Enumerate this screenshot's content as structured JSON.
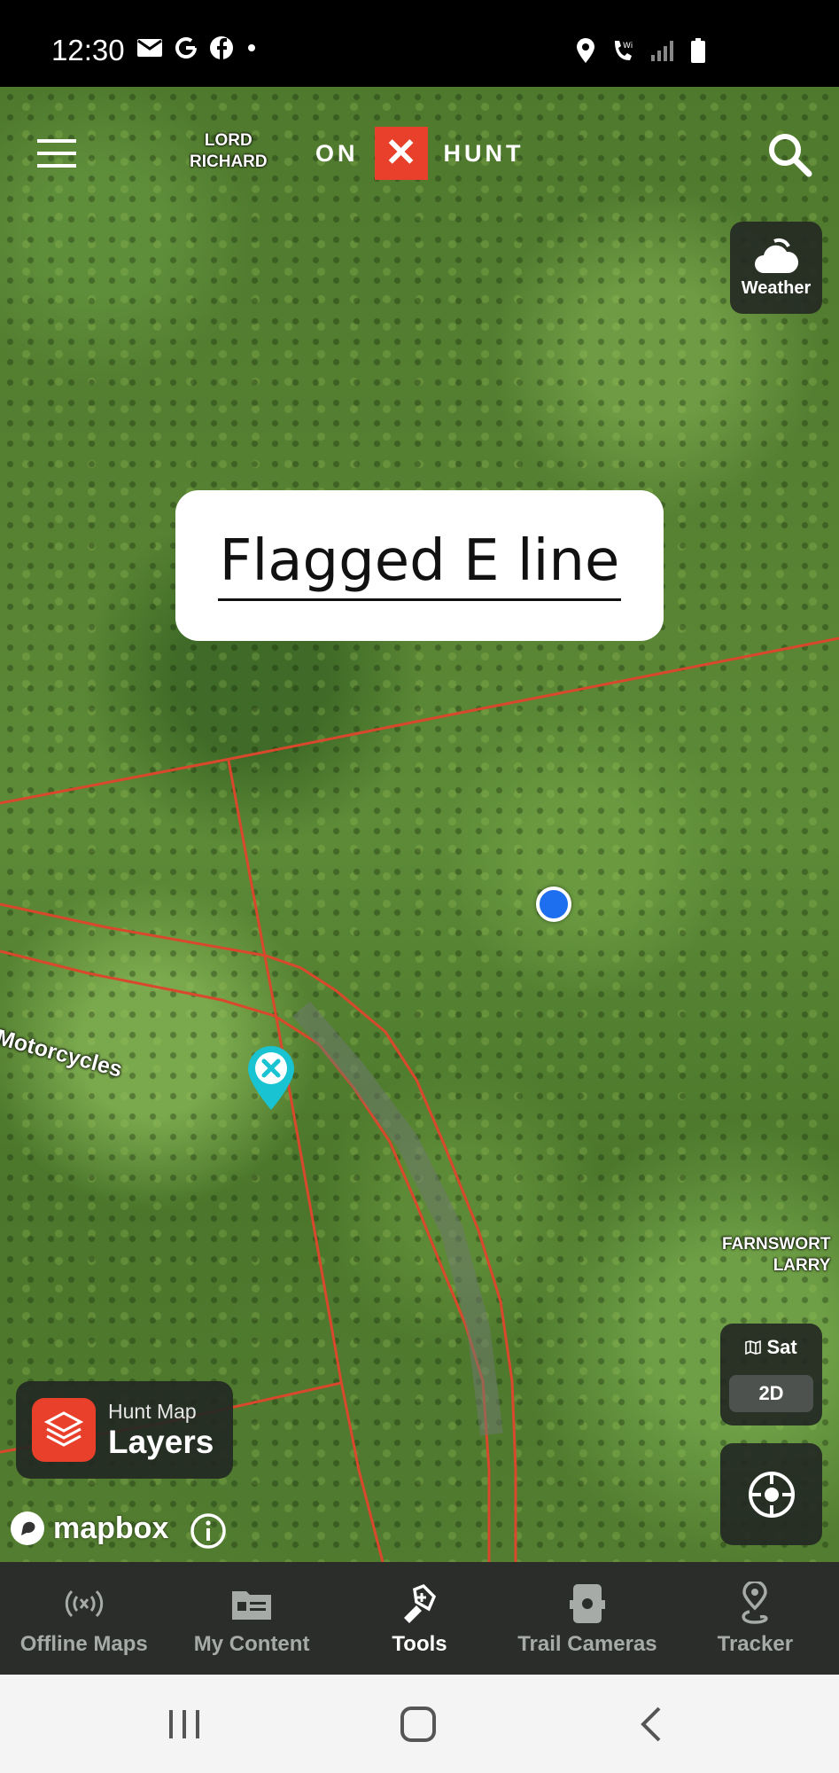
{
  "status_bar": {
    "time": "12:30",
    "left_icons": [
      "mail-icon",
      "google-icon",
      "facebook-icon",
      "dot-icon"
    ],
    "right_icons": [
      "location-icon",
      "wifi-calling-icon",
      "signal-icon",
      "battery-icon"
    ]
  },
  "header": {
    "logo_on": "ON",
    "logo_x": "✕",
    "logo_hunt": "HUNT",
    "menu_icon": "hamburger-menu-icon",
    "search_icon": "search-icon"
  },
  "map": {
    "property_labels": [
      {
        "line1": "LORD",
        "line2": "RICHARD"
      },
      {
        "line1": "FARNSWORT",
        "line2": "LARRY"
      }
    ],
    "road_label": "Motorcycles",
    "annotation": "Flagged E line",
    "accent_color": "#e8402a",
    "boundary_color": "#d9482c",
    "pin_color": "#19c3d1",
    "location_dot_color": "#1e6ff0"
  },
  "weather": {
    "label": "Weather",
    "icon": "cloud-icon"
  },
  "layers": {
    "sub": "Hunt Map",
    "main": "Layers",
    "icon": "layers-icon"
  },
  "map_type": {
    "sat": "Sat",
    "mode": "2D",
    "icon": "map-icon"
  },
  "locate": {
    "icon": "crosshair-icon"
  },
  "attribution": {
    "mapbox": "mapbox",
    "info_icon": "info-icon"
  },
  "bottom_nav": {
    "items": [
      {
        "label": "Offline Maps",
        "icon": "offline-maps-icon"
      },
      {
        "label": "My Content",
        "icon": "folder-icon"
      },
      {
        "label": "Tools",
        "icon": "tools-icon",
        "active": true
      },
      {
        "label": "Trail Cameras",
        "icon": "trail-camera-icon"
      },
      {
        "label": "Tracker",
        "icon": "tracker-icon"
      }
    ]
  },
  "system_nav": {
    "buttons": [
      "recents-icon",
      "home-icon",
      "back-icon"
    ]
  }
}
